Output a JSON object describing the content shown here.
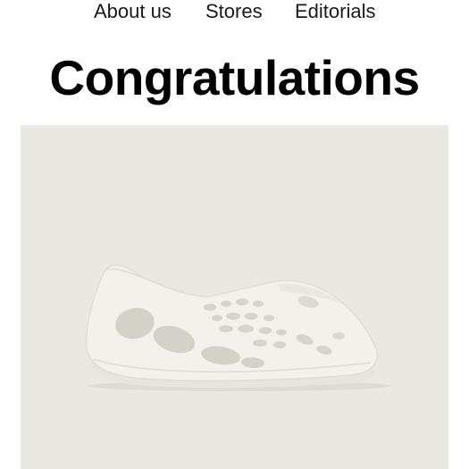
{
  "nav": {
    "items": [
      {
        "label": "About us"
      },
      {
        "label": "Stores"
      },
      {
        "label": "Editorials"
      }
    ]
  },
  "main": {
    "headline": "Congratulations"
  },
  "product": {
    "image_icon": "foam-runner-shoe-image",
    "background_color": "#eae9e1",
    "shoe_color": "#f2f1eb"
  }
}
